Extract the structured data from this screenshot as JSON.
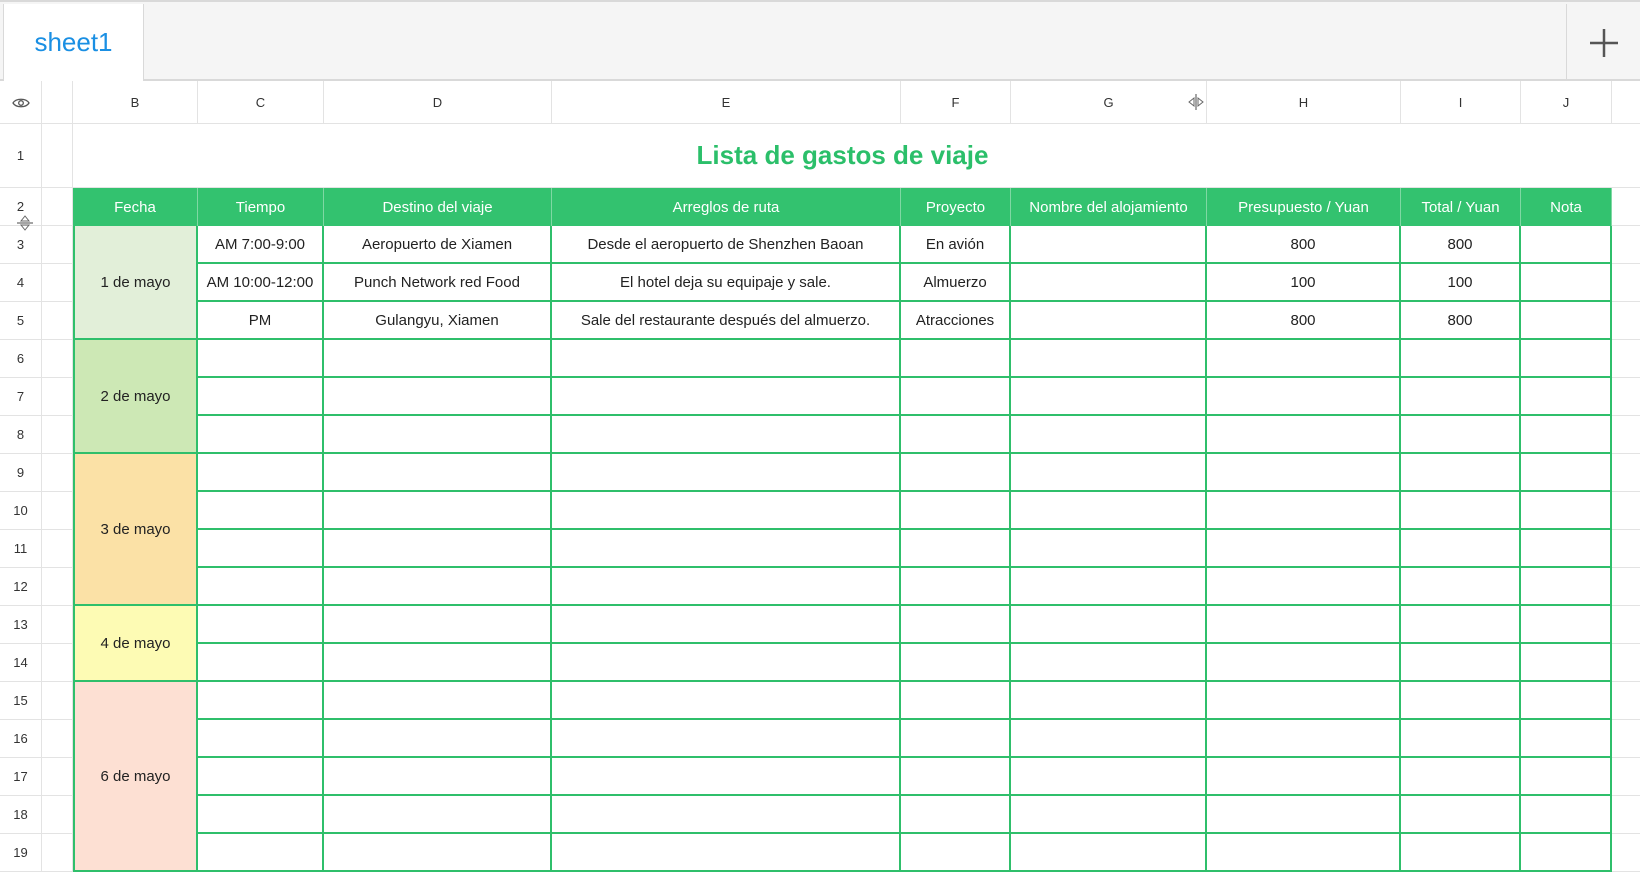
{
  "tabs": {
    "active": "sheet1",
    "add_icon": "plus-icon"
  },
  "column_headers": [
    "B",
    "C",
    "D",
    "E",
    "F",
    "G",
    "H",
    "I",
    "J"
  ],
  "row_numbers": [
    "1",
    "2",
    "3",
    "4",
    "5",
    "6",
    "7",
    "8",
    "9",
    "10",
    "11",
    "12",
    "13",
    "14",
    "15",
    "16",
    "17",
    "18",
    "19"
  ],
  "sheet": {
    "title": "Lista de gastos de viaje",
    "headers": [
      "Fecha",
      "Tiempo",
      "Destino del viaje",
      "Arreglos de ruta",
      "Proyecto",
      "Nombre del alojamiento",
      "Presupuesto / Yuan",
      "Total / Yuan",
      "Nota"
    ],
    "dates": [
      {
        "label": "1 de mayo",
        "color": "#e2efd9"
      },
      {
        "label": "2 de mayo",
        "color": "#cde8b5"
      },
      {
        "label": "3 de mayo",
        "color": "#fbe1a6"
      },
      {
        "label": "4 de mayo",
        "color": "#fdfbb4"
      },
      {
        "label": "6 de mayo",
        "color": "#fde0d3"
      }
    ],
    "rows": [
      [
        "AM 7:00-9:00",
        "Aeropuerto de Xiamen",
        "Desde el aeropuerto de Shenzhen Baoan",
        "En avión",
        "",
        "800",
        "800",
        ""
      ],
      [
        "AM 10:00-12:00",
        "Punch Network red Food",
        "El hotel deja su equipaje y sale.",
        "Almuerzo",
        "",
        "100",
        "100",
        ""
      ],
      [
        "PM",
        "Gulangyu, Xiamen",
        "Sale del restaurante después del almuerzo.",
        "Atracciones",
        "",
        "800",
        "800",
        ""
      ]
    ]
  },
  "colors": {
    "accent": "#33c26f",
    "title": "#2bbf6a",
    "tab_text": "#1a8fe3"
  }
}
